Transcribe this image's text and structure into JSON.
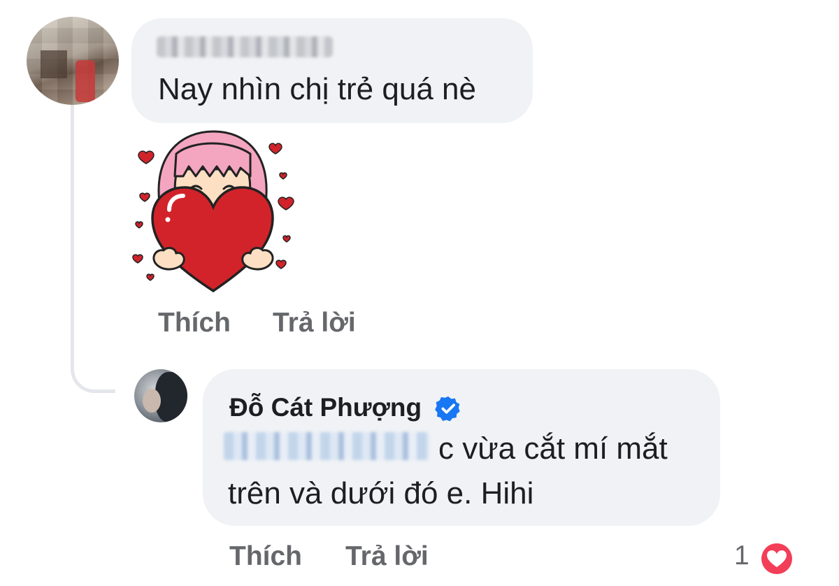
{
  "comments": [
    {
      "author": "",
      "text": "Nay nhìn chị trẻ quá nè",
      "sticker": "girl-hugging-heart-sticker",
      "actions": {
        "like": "Thích",
        "reply": "Trả lời"
      }
    }
  ],
  "reply": {
    "author": "Đỗ Cát Phượng",
    "verified": true,
    "text_line1": "c vừa cắt mí mắt",
    "text_line2": "trên và dưới đó e. Hihi",
    "actions": {
      "like": "Thích",
      "reply": "Trả lời"
    },
    "reaction_count": "1",
    "reaction_type": "heart"
  },
  "colors": {
    "bubble": "#f0f2f5",
    "action_text": "#65676b",
    "verified": "#1877f2",
    "heart": "#f33e58"
  }
}
